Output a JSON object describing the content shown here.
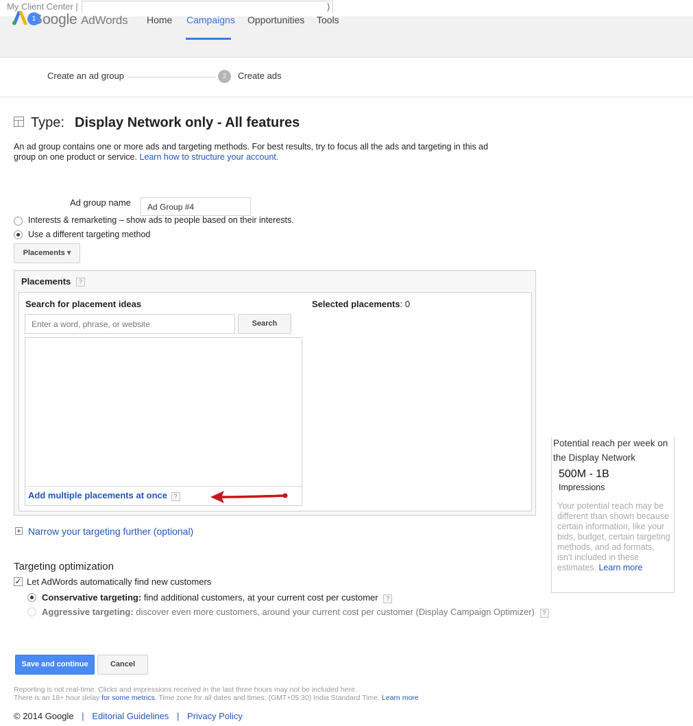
{
  "client_bar": {
    "label": "My Client Center |",
    "close_paren": ")"
  },
  "header": {
    "brand_google": "Google",
    "brand_product": "AdWords",
    "nav": [
      "Home",
      "Campaigns",
      "Opportunities",
      "Tools"
    ],
    "active_nav": "Campaigns"
  },
  "steps": [
    {
      "number": "1",
      "label": "Create an ad group"
    },
    {
      "number": "2",
      "label": "Create ads"
    }
  ],
  "type_heading": {
    "prefix": "Type:",
    "value": "Display Network only - All features"
  },
  "description": {
    "text": "An ad group contains one or more ads and targeting methods. For best results, try to focus all the ads and targeting in this ad group on one product or service.",
    "link": "Learn how to structure your account."
  },
  "ad_group": {
    "label": "Ad group name",
    "value": "Ad Group #4"
  },
  "targeting_options": [
    {
      "label": "Interests & remarketing – show ads to people based on their interests.",
      "selected": false
    },
    {
      "label": "Use a different targeting method",
      "selected": true
    }
  ],
  "method_dropdown": {
    "label": "Placements",
    "caret": "▾"
  },
  "placements_panel": {
    "title": "Placements",
    "help": "?",
    "search_heading": "Search for placement ideas",
    "search_placeholder": "Enter a word, phrase, or website",
    "search_button": "Search",
    "selected_label": "Selected placements",
    "selected_count": ": 0",
    "add_multiple": "Add multiple placements at once"
  },
  "narrow_link": "Narrow your targeting further (optional)",
  "targeting_optimization": {
    "title": "Targeting optimization",
    "checkbox_label": "Let AdWords automatically find new customers",
    "checked": true,
    "conservative_bold": "Conservative targeting:",
    "conservative_text": " find additional customers, at your current cost per customer",
    "aggressive_bold": "Aggressive targeting:",
    "aggressive_text": " discover even more customers, around your current cost per customer (Display Campaign Optimizer)"
  },
  "actions": {
    "save": "Save and continue",
    "cancel": "Cancel"
  },
  "footnote": {
    "line1": "Reporting is not real-time. Clicks and impressions received in the last three hours may not be included here.",
    "line2_pre": "There is an 18+ hour delay ",
    "line2_link": "for some metrics.",
    "line2_mid": " Time zone for all dates and times: (GMT+05:30) India Standard Time. ",
    "line2_link2": "Learn more"
  },
  "footer": {
    "copyright": "© 2014 Google",
    "sep": "|",
    "link1": "Editorial Guidelines",
    "link2": "Privacy Policy"
  },
  "reach": {
    "title": "Potential reach per week on the Display Network",
    "value": "500M - 1B",
    "unit": "Impressions",
    "note": "Your potential reach may be different than shown because certain information, like your bids, budget, certain targeting methods, and ad formats, isn't included in these estimates.",
    "note_link": "Learn more"
  },
  "colors": {
    "accent": "#4a8af4",
    "link": "#2255bb",
    "annotation_arrow": "#c8161d"
  }
}
